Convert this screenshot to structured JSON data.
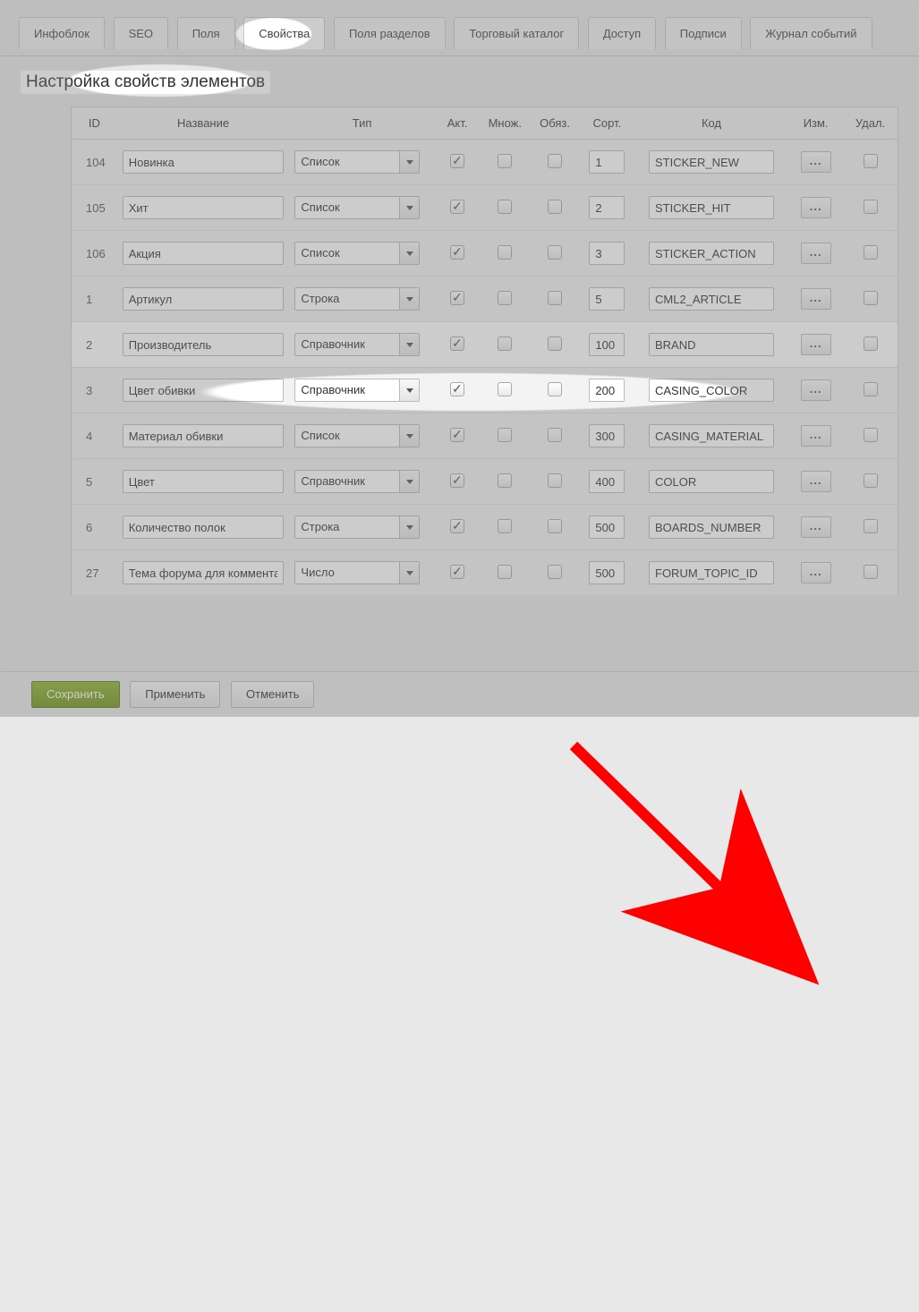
{
  "tabs": {
    "infoblock": "Инфоблок",
    "seo": "SEO",
    "fields": "Поля",
    "properties": "Свойства",
    "section_fields": "Поля разделов",
    "catalog": "Торговый каталог",
    "access": "Доступ",
    "captions": "Подписи",
    "event_log": "Журнал событий"
  },
  "heading": "Настройка свойств элементов",
  "columns": {
    "id": "ID",
    "name": "Название",
    "type": "Тип",
    "active": "Акт.",
    "multiple": "Множ.",
    "required": "Обяз.",
    "sort": "Сорт.",
    "code": "Код",
    "edit": "Изм.",
    "delete": "Удал."
  },
  "ellipsis": "...",
  "rows": [
    {
      "id": "104",
      "name": "Новинка",
      "type": "Список",
      "active": true,
      "sort": "1",
      "code": "STICKER_NEW",
      "highlight": false
    },
    {
      "id": "105",
      "name": "Хит",
      "type": "Список",
      "active": true,
      "sort": "2",
      "code": "STICKER_HIT",
      "highlight": false
    },
    {
      "id": "106",
      "name": "Акция",
      "type": "Список",
      "active": true,
      "sort": "3",
      "code": "STICKER_ACTION",
      "highlight": false
    },
    {
      "id": "1",
      "name": "Артикул",
      "type": "Строка",
      "active": true,
      "sort": "5",
      "code": "CML2_ARTICLE",
      "highlight": false
    },
    {
      "id": "2",
      "name": "Производитель",
      "type": "Справочник",
      "active": true,
      "sort": "100",
      "code": "BRAND",
      "highlight": true
    },
    {
      "id": "3",
      "name": "Цвет обивки",
      "type": "Справочник",
      "active": true,
      "sort": "200",
      "code": "CASING_COLOR",
      "highlight": false
    },
    {
      "id": "4",
      "name": "Материал обивки",
      "type": "Список",
      "active": true,
      "sort": "300",
      "code": "CASING_MATERIAL",
      "highlight": false
    },
    {
      "id": "5",
      "name": "Цвет",
      "type": "Справочник",
      "active": true,
      "sort": "400",
      "code": "COLOR",
      "highlight": false
    },
    {
      "id": "6",
      "name": "Количество полок",
      "type": "Строка",
      "active": true,
      "sort": "500",
      "code": "BOARDS_NUMBER",
      "highlight": false
    },
    {
      "id": "27",
      "name": "Тема форума для комментариев",
      "type": "Число",
      "active": true,
      "sort": "500",
      "code": "FORUM_TOPIC_ID",
      "highlight": false
    }
  ],
  "buttons": {
    "save": "Сохранить",
    "apply": "Применить",
    "cancel": "Отменить"
  }
}
